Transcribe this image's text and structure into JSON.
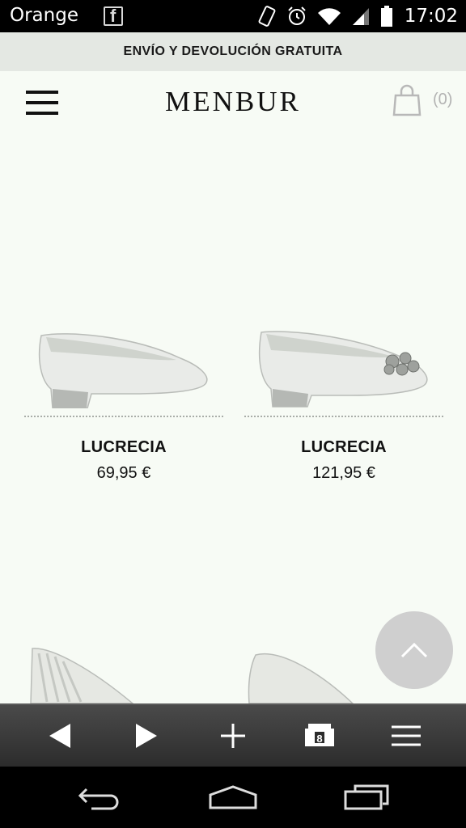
{
  "status_bar": {
    "carrier": "Orange",
    "time": "17:02"
  },
  "site": {
    "promo_banner": "ENVÍO Y DEVOLUCIÓN GRATUITA",
    "logo": "MENBUR",
    "cart_count": "(0)"
  },
  "products": [
    {
      "name": "LUCRECIA",
      "price": "69,95 €"
    },
    {
      "name": "LUCRECIA",
      "price": "121,95 €"
    }
  ],
  "colors": {
    "page_background": "#f7fbf5",
    "banner_background": "#e4e8e3",
    "scroll_button": "#cfcfcf"
  }
}
